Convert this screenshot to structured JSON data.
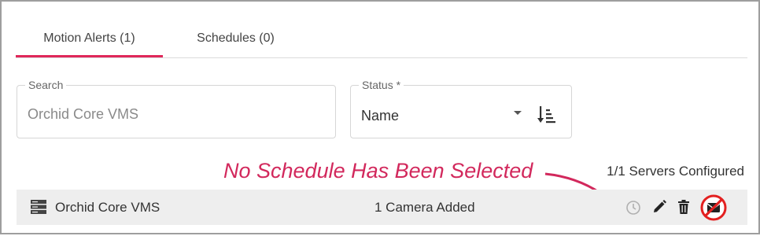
{
  "tabs": [
    {
      "label": "Motion Alerts (1)",
      "active": true
    },
    {
      "label": "Schedules (0)",
      "active": false
    }
  ],
  "search": {
    "label": "Search",
    "value": "Orchid Core VMS"
  },
  "status": {
    "label": "Status *",
    "value": "Name"
  },
  "annotation": "No Schedule Has Been Selected",
  "servers_configured": "1/1 Servers Configured",
  "row": {
    "server_name": "Orchid Core VMS",
    "camera_count": "1 Camera Added"
  },
  "colors": {
    "accent": "#e0285a",
    "annotation": "#d2285c",
    "row_bg": "#eeeeee"
  },
  "icons": [
    "sort-icon",
    "server-icon",
    "clock-icon",
    "edit-icon",
    "delete-icon",
    "disable-alert-icon"
  ]
}
